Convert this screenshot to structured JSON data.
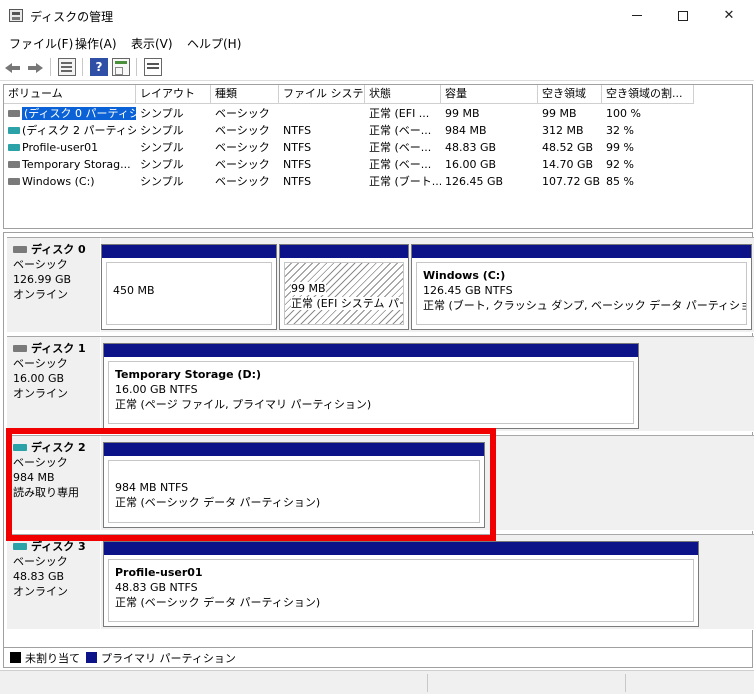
{
  "window": {
    "title": "ディスクの管理"
  },
  "menu": [
    "ファイル(F)",
    "操作(A)",
    "表示(V)",
    "ヘルプ(H)"
  ],
  "toolbar": {
    "help_glyph": "?"
  },
  "volume_list": {
    "columns": [
      "ボリューム",
      "レイアウト",
      "種類",
      "ファイル システム",
      "状態",
      "容量",
      "空き領域",
      "空き領域の割..."
    ],
    "rows": [
      [
        "(ディスク 0 パーティシ...",
        "シンプル",
        "ベーシック",
        "",
        "正常 (EFI ...",
        "99 MB",
        "99 MB",
        "100 %"
      ],
      [
        "(ディスク 2 パーティシ...",
        "シンプル",
        "ベーシック",
        "NTFS",
        "正常 (ベー...",
        "984 MB",
        "312 MB",
        "32 %"
      ],
      [
        "Profile-user01",
        "シンプル",
        "ベーシック",
        "NTFS",
        "正常 (ベー...",
        "48.83 GB",
        "48.52 GB",
        "99 %"
      ],
      [
        "Temporary Storag...",
        "シンプル",
        "ベーシック",
        "NTFS",
        "正常 (ベー...",
        "16.00 GB",
        "14.70 GB",
        "92 %"
      ],
      [
        "Windows (C:)",
        "シンプル",
        "ベーシック",
        "NTFS",
        "正常 (ブート...",
        "126.45 GB",
        "107.72 GB",
        "85 %"
      ]
    ]
  },
  "disks": [
    {
      "name": "ディスク 0",
      "type": "ベーシック",
      "size": "126.99 GB",
      "status": "オンライン",
      "partitions": [
        {
          "title": "",
          "line1": "450 MB",
          "line2": ""
        },
        {
          "title": "",
          "line1": "99 MB",
          "line2": "正常 (EFI システム パーテ"
        },
        {
          "title": "Windows  (C:)",
          "line1": "126.45 GB NTFS",
          "line2": "正常 (ブート, クラッシュ ダンプ, ベーシック データ パーティション)"
        }
      ]
    },
    {
      "name": "ディスク 1",
      "type": "ベーシック",
      "size": "16.00 GB",
      "status": "オンライン",
      "partitions": [
        {
          "title": "Temporary Storage  (D:)",
          "line1": "16.00 GB NTFS",
          "line2": "正常 (ページ ファイル, プライマリ パーティション)"
        }
      ]
    },
    {
      "name": "ディスク 2",
      "type": "ベーシック",
      "size": "984 MB",
      "status": "読み取り専用",
      "partitions": [
        {
          "title": "",
          "line1": "984 MB NTFS",
          "line2": "正常 (ベーシック データ パーティション)"
        }
      ]
    },
    {
      "name": "ディスク 3",
      "type": "ベーシック",
      "size": "48.83 GB",
      "status": "オンライン",
      "partitions": [
        {
          "title": "Profile-user01",
          "line1": "48.83 GB NTFS",
          "line2": "正常 (ベーシック データ パーティション)"
        }
      ]
    }
  ],
  "legend": {
    "unallocated": "未割り当て",
    "primary": "プライマリ パーティション"
  },
  "colors": {
    "partition_bar": "#0c1389",
    "highlight": "#f00000",
    "selection": "#0a62d6"
  }
}
